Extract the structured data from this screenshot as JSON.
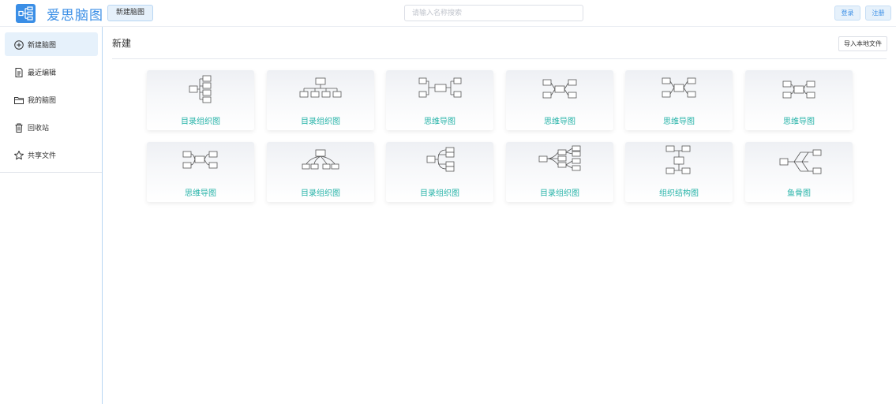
{
  "header": {
    "brand": "爱思脑图",
    "new_label": "新建脑图",
    "search_placeholder": "请输入名称搜索",
    "login_label": "登录",
    "register_label": "注册"
  },
  "sidebar": {
    "items": [
      {
        "label": "新建脑图",
        "icon": "plus-circle-icon"
      },
      {
        "label": "最近编辑",
        "icon": "document-icon"
      },
      {
        "label": "我的脑图",
        "icon": "folder-icon"
      },
      {
        "label": "回收站",
        "icon": "trash-icon"
      },
      {
        "label": "共享文件",
        "icon": "star-icon"
      }
    ]
  },
  "main": {
    "title": "新建",
    "import_label": "导入本地文件",
    "templates": [
      {
        "label": "目录组织图",
        "icon": "tree-right-icon"
      },
      {
        "label": "目录组织图",
        "icon": "org-down-icon"
      },
      {
        "label": "思维导图",
        "icon": "mindmap-wide-icon"
      },
      {
        "label": "思维导图",
        "icon": "mindmap-icon"
      },
      {
        "label": "思维导图",
        "icon": "mindmap-icon"
      },
      {
        "label": "思维导图",
        "icon": "mindmap-icon"
      },
      {
        "label": "思维导图",
        "icon": "mindmap-icon"
      },
      {
        "label": "目录组织图",
        "icon": "org-down-curved-icon"
      },
      {
        "label": "目录组织图",
        "icon": "tree-bracket-icon"
      },
      {
        "label": "目录组织图",
        "icon": "tree-logic-icon"
      },
      {
        "label": "组织结构图",
        "icon": "org-vertical-icon"
      },
      {
        "label": "鱼骨图",
        "icon": "fishbone-icon"
      }
    ]
  },
  "colors": {
    "accent": "#3a8ee6",
    "card_label": "#26b3a8",
    "active_bg": "#e6f1fb"
  }
}
